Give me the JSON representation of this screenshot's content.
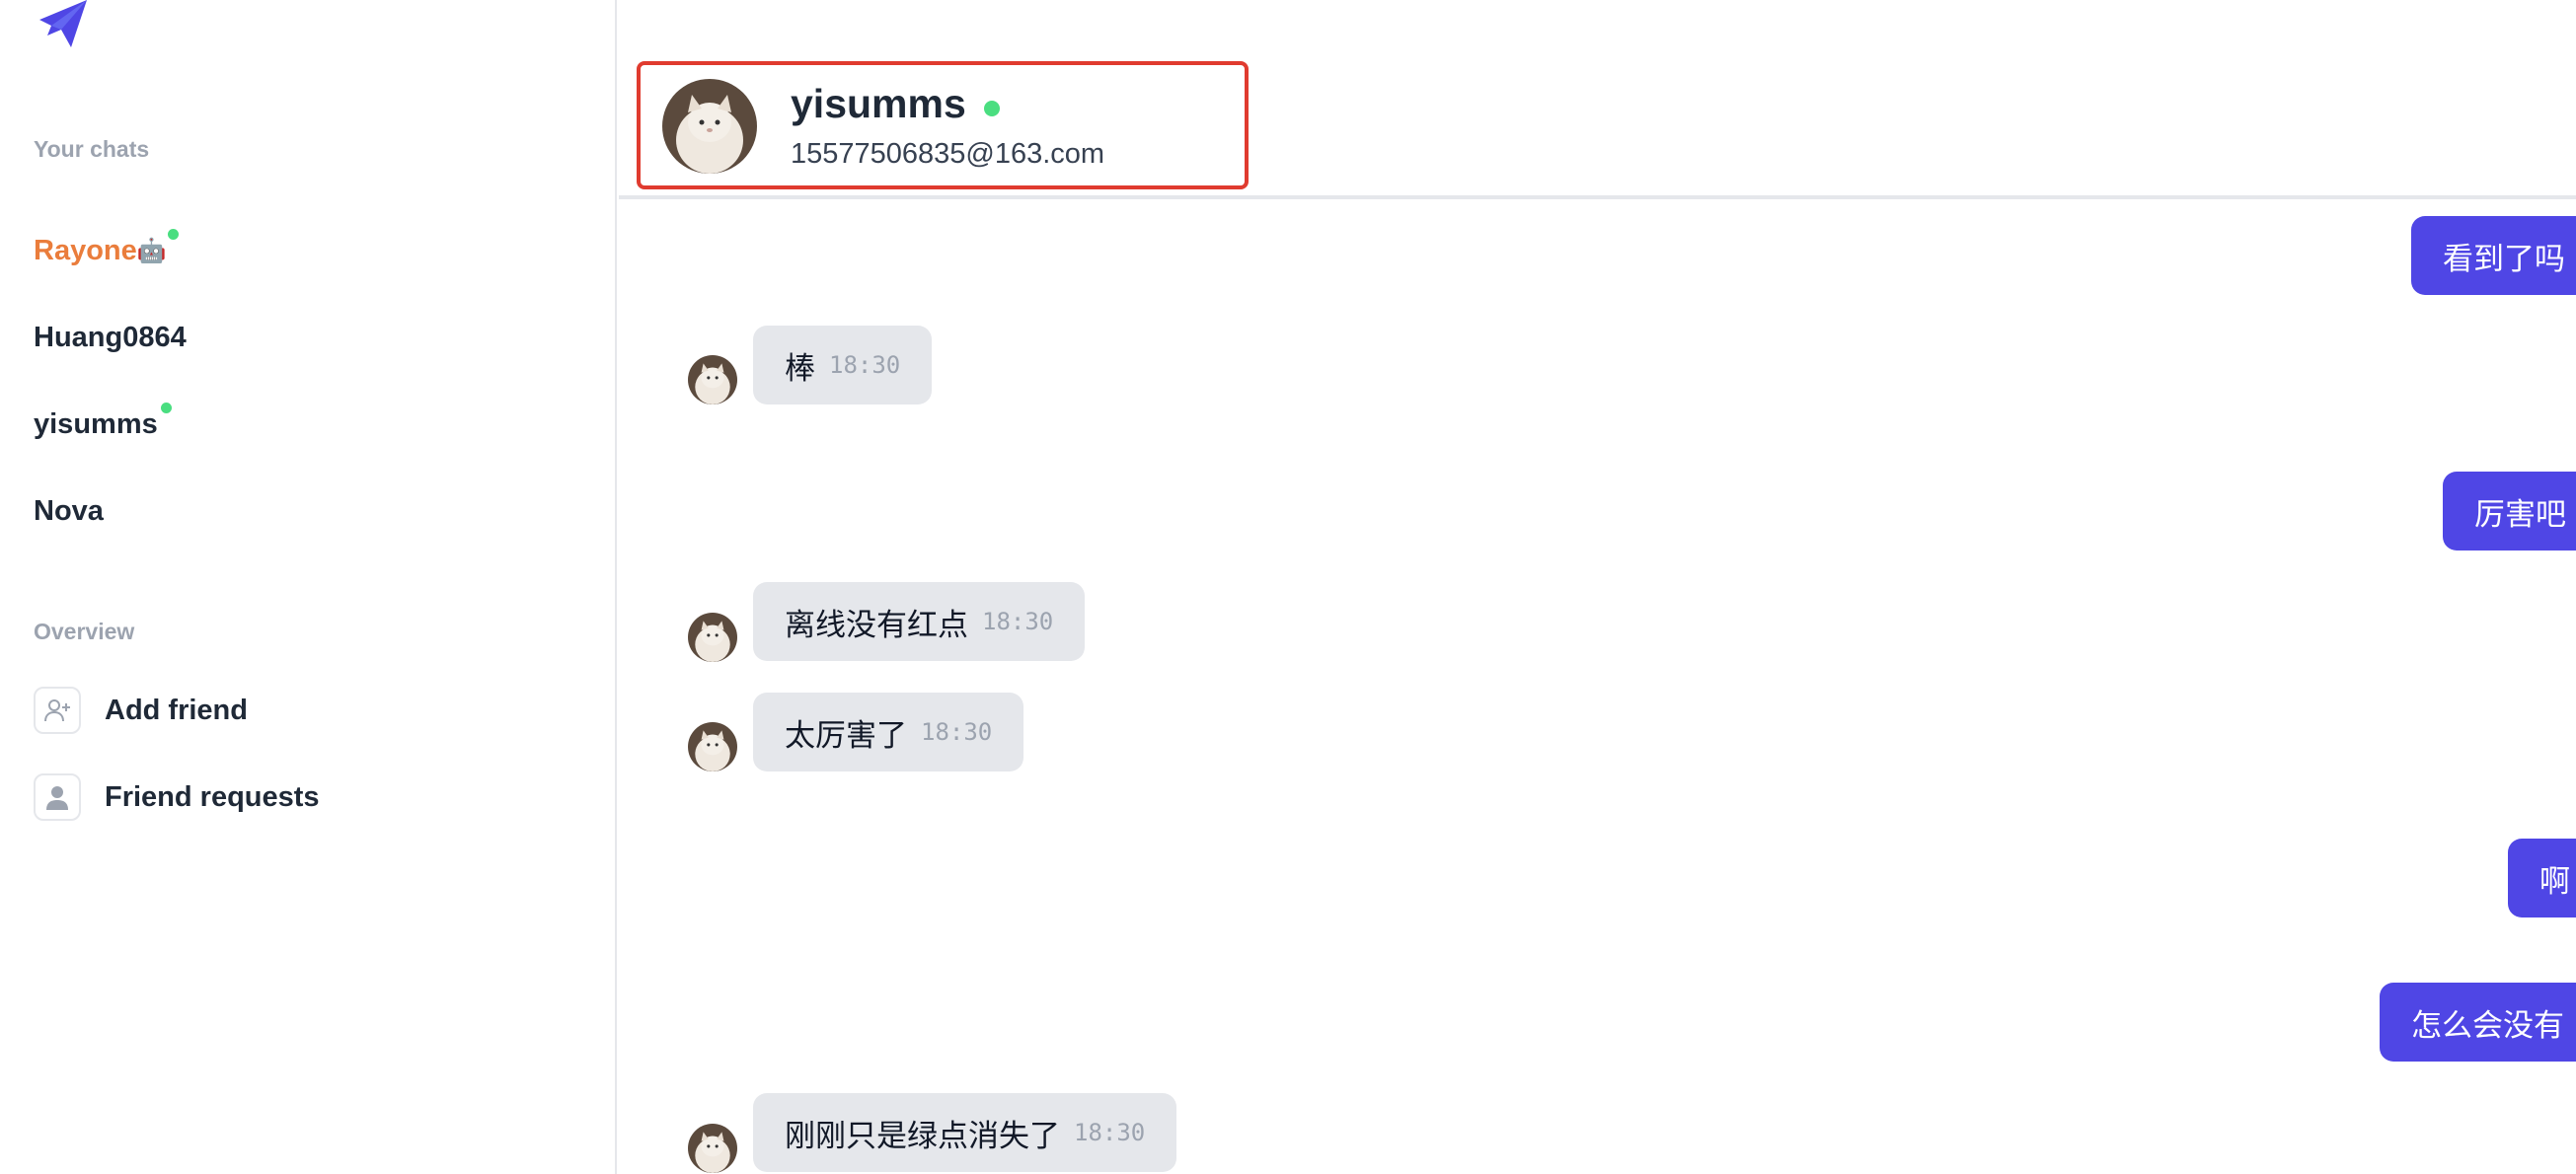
{
  "sidebar": {
    "chats_label": "Your chats",
    "chats": [
      {
        "name": "Rayone",
        "emoji": "🤖",
        "online": true,
        "active": true
      },
      {
        "name": "Huang0864",
        "online": false
      },
      {
        "name": "yisumms",
        "online": true
      },
      {
        "name": "Nova",
        "online": false
      }
    ],
    "overview_label": "Overview",
    "overview": [
      {
        "label": "Add friend",
        "icon": "user-plus-icon"
      },
      {
        "label": "Friend requests",
        "icon": "user-icon"
      }
    ]
  },
  "header": {
    "name": "yisumms",
    "email": "15577506835@163.com",
    "online": true
  },
  "messages": [
    {
      "from": "me",
      "text": "看到了吗"
    },
    {
      "from": "them",
      "text": "棒",
      "time": "18:30"
    },
    {
      "from": "me",
      "text": "厉害吧"
    },
    {
      "from": "them",
      "text": "离线没有红点",
      "time": "18:30"
    },
    {
      "from": "them",
      "text": "太厉害了",
      "time": "18:30"
    },
    {
      "from": "me",
      "text": "啊"
    },
    {
      "from": "me",
      "text": "怎么会没有"
    },
    {
      "from": "them",
      "text": "刚刚只是绿点消失了",
      "time": "18:30"
    }
  ],
  "colors": {
    "accent": "#4f46e5",
    "active_chat": "#ea7d3c",
    "online": "#4ade80",
    "highlight_border": "#e03b2f"
  }
}
